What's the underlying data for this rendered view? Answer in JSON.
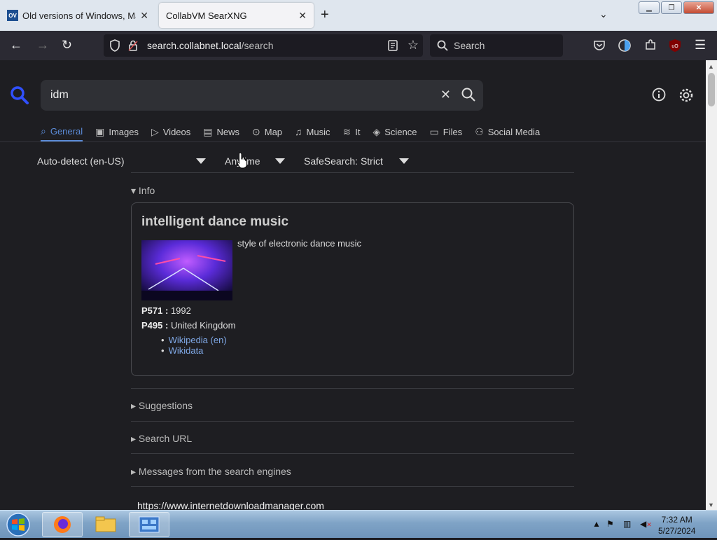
{
  "browser": {
    "tabs": [
      {
        "title": "Old versions of Windows, Mac",
        "favicon": "OV",
        "active": false
      },
      {
        "title": "CollabVM SearXNG",
        "active": true
      }
    ],
    "url_host": "search.collabnet.local",
    "url_path": "/search",
    "search_placeholder": "Search"
  },
  "search": {
    "query": "idm"
  },
  "categories": [
    {
      "label": "General",
      "icon": "search-icon",
      "active": true
    },
    {
      "label": "Images",
      "icon": "image-icon"
    },
    {
      "label": "Videos",
      "icon": "play-icon"
    },
    {
      "label": "News",
      "icon": "newspaper-icon"
    },
    {
      "label": "Map",
      "icon": "map-pin-icon"
    },
    {
      "label": "Music",
      "icon": "music-icon"
    },
    {
      "label": "It",
      "icon": "layers-icon"
    },
    {
      "label": "Science",
      "icon": "graduation-icon"
    },
    {
      "label": "Files",
      "icon": "archive-icon"
    },
    {
      "label": "Social Media",
      "icon": "people-icon"
    }
  ],
  "filters": {
    "language": "Auto-detect (en-US)",
    "time": "Anytime",
    "safesearch": "SafeSearch: Strict"
  },
  "info": {
    "section_label": "Info",
    "title": "intelligent dance music",
    "description": "style of electronic dance music",
    "props": [
      {
        "key": "P571 :",
        "value": "1992"
      },
      {
        "key": "P495 :",
        "value": "United Kingdom"
      }
    ],
    "links": [
      "Wikipedia (en)",
      "Wikidata"
    ]
  },
  "sections": [
    "Suggestions",
    "Search URL",
    "Messages from the search engines"
  ],
  "first_result_url": "https://www.internetdownloadmanager.com",
  "taskbar": {
    "time": "7:32 AM",
    "date": "5/27/2024"
  }
}
